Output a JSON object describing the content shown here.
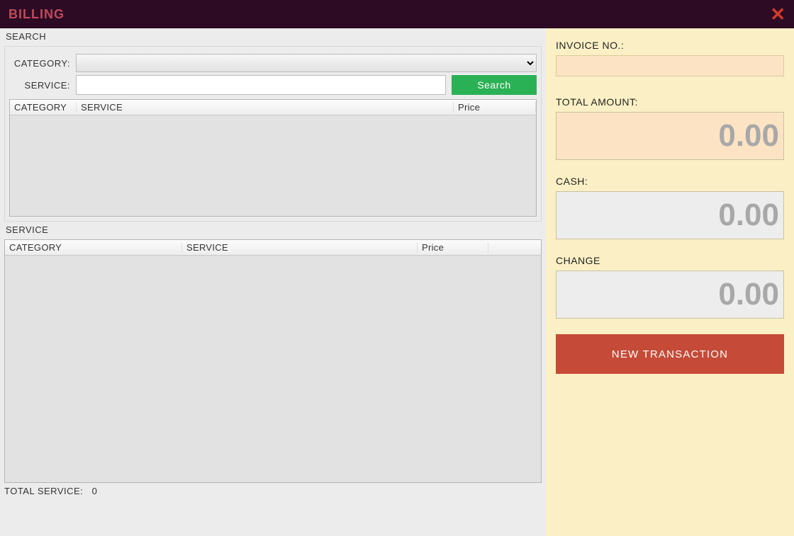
{
  "titlebar": {
    "title": "BILLING"
  },
  "search": {
    "group_label": "SEARCH",
    "category_label": "CATEGORY:",
    "service_label": "SERVICE:",
    "category_value": "",
    "service_value": "",
    "search_button": "Search",
    "grid_headers": {
      "category": "CATEGORY",
      "service": "SERVICE",
      "price": "Price"
    }
  },
  "service_panel": {
    "group_label": "SERVICE",
    "grid_headers": {
      "category": "CATEGORY",
      "service": "SERVICE",
      "price": "Price"
    },
    "total_service_label": "TOTAL SERVICE:",
    "total_service_value": "0"
  },
  "summary": {
    "invoice_label": "INVOICE NO.:",
    "invoice_value": "",
    "total_label": "TOTAL AMOUNT:",
    "total_value": "0.00",
    "cash_label": "CASH:",
    "cash_value": "0.00",
    "change_label": "CHANGE",
    "change_value": "0.00",
    "new_transaction": "NEW TRANSACTION"
  }
}
